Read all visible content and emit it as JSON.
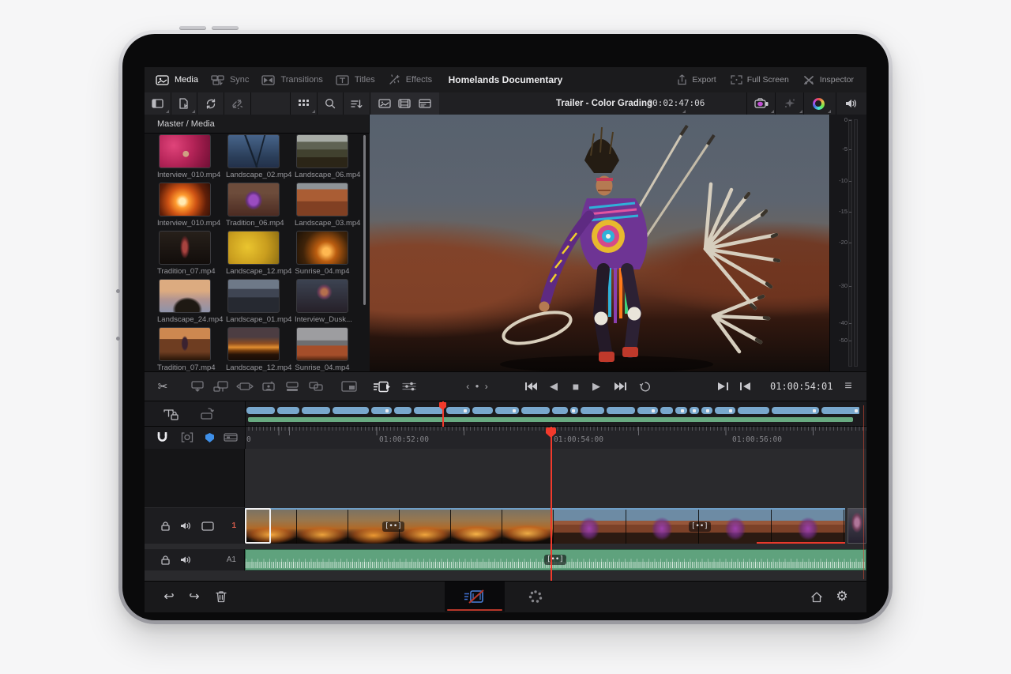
{
  "colors": {
    "accent_red": "#f23a2c",
    "clip_blue": "#79a8cd",
    "audio_green": "#5fa27d",
    "flag_blue": "#3e8fe8",
    "camera_accent": "#c24fd4"
  },
  "icons": {
    "scissors": "✂",
    "hamburger": "≡",
    "gear": "⚙",
    "undo": "↩",
    "redo": "↪",
    "jog_left": "‹",
    "jog_dot": "●",
    "jog_right": "›",
    "step_back": "◀",
    "stop": "■",
    "play": "▶"
  },
  "top_bar": {
    "tabs": [
      {
        "label": "Media"
      },
      {
        "label": "Sync"
      },
      {
        "label": "Transitions"
      },
      {
        "label": "Titles"
      },
      {
        "label": "Effects"
      }
    ],
    "title": "Homelands Documentary",
    "export_label": "Export",
    "fullscreen_label": "Full Screen",
    "inspector_label": "Inspector"
  },
  "media_panel": {
    "breadcrumb": "Master / Media",
    "clips": [
      {
        "name": "Interview_010.mp4"
      },
      {
        "name": "Landscape_02.mp4"
      },
      {
        "name": "Landscape_06.mp4"
      },
      {
        "name": "Interview_010.mp4"
      },
      {
        "name": "Tradition_06.mp4"
      },
      {
        "name": "Landscape_03.mp4"
      },
      {
        "name": "Tradition_07.mp4"
      },
      {
        "name": "Landscape_12.mp4"
      },
      {
        "name": "Sunrise_04.mp4"
      },
      {
        "name": "Landscape_24.mp4"
      },
      {
        "name": "Landscape_01.mp4"
      },
      {
        "name": "Interview_Dusk..."
      },
      {
        "name": "Tradition_07.mp4"
      },
      {
        "name": "Landscape_12.mp4"
      },
      {
        "name": "Sunrise_04.mp4"
      }
    ]
  },
  "viewer": {
    "title": "Trailer - Color Grading",
    "timecode": "00:02:47:06",
    "meter_ticks": [
      "0",
      "-5",
      "-10",
      "-15",
      "-20",
      "-30",
      "-40",
      "-50"
    ]
  },
  "transport": {
    "timecode": "01:00:54:01"
  },
  "timeline": {
    "ruler_origin": "0",
    "ruler_ticks": [
      "01:00:52:00",
      "01:00:54:00",
      "01:00:56:00"
    ],
    "video_track_label": "1",
    "audio_track_label": "A1",
    "clip_badge": "[••]"
  }
}
